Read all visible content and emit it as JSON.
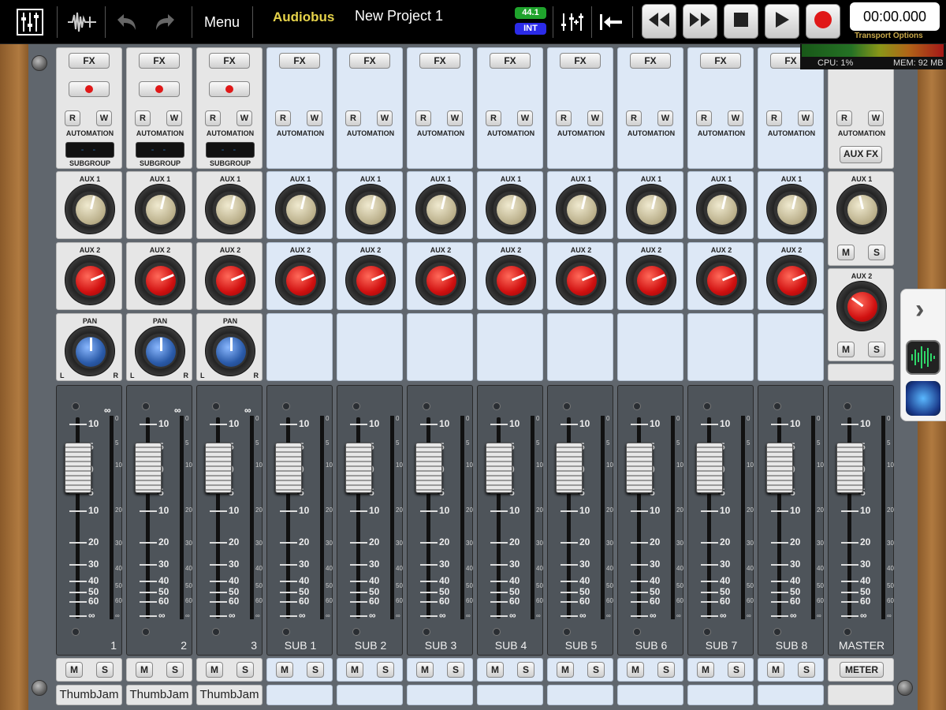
{
  "topbar": {
    "menu_label": "Menu",
    "audiobus_label": "Audiobus",
    "project_title": "New Project 1",
    "sample_rate": "44.1",
    "clock_source": "INT",
    "timecode": "00:00.000",
    "transport_options_label": "Transport Options",
    "icons": [
      "mixer-icon",
      "waveform-edit-icon",
      "undo-icon",
      "redo-icon",
      "add-track-icon",
      "return-to-start-icon",
      "rewind-icon",
      "fast-forward-icon",
      "stop-icon",
      "play-icon",
      "record-icon"
    ]
  },
  "status": {
    "cpu": "CPU:  1%",
    "mem": "MEM: 92 MB"
  },
  "labels": {
    "fx": "FX",
    "r": "R",
    "w": "W",
    "automation": "AUTOMATION",
    "subgroup": "SUBGROUP",
    "aux1": "AUX 1",
    "aux2": "AUX 2",
    "pan": "PAN",
    "pan_l": "L",
    "pan_r": "R",
    "mute": "M",
    "solo": "S",
    "aux_fx": "AUX FX",
    "meter": "METER",
    "link": "∞"
  },
  "fader_scale": [
    "10",
    "5",
    "0",
    "5",
    "10",
    "20",
    "30",
    "40",
    "50",
    "60",
    "∞"
  ],
  "meter_scale": [
    "0",
    "5",
    "10",
    "20",
    "30",
    "40",
    "50",
    "60",
    "∞"
  ],
  "channels": [
    {
      "name": "1",
      "input": "ThumbJam",
      "type": "track",
      "aux1": 0.55,
      "aux2": 0.75,
      "pan": 0.5
    },
    {
      "name": "2",
      "input": "ThumbJam",
      "type": "track",
      "aux1": 0.55,
      "aux2": 0.75,
      "pan": 0.5
    },
    {
      "name": "3",
      "input": "ThumbJam",
      "type": "track",
      "aux1": 0.55,
      "aux2": 0.75,
      "pan": 0.5
    },
    {
      "name": "SUB 1",
      "input": "",
      "type": "sub",
      "aux1": 0.55,
      "aux2": 0.75
    },
    {
      "name": "SUB 2",
      "input": "",
      "type": "sub",
      "aux1": 0.55,
      "aux2": 0.75
    },
    {
      "name": "SUB 3",
      "input": "",
      "type": "sub",
      "aux1": 0.55,
      "aux2": 0.75
    },
    {
      "name": "SUB 4",
      "input": "",
      "type": "sub",
      "aux1": 0.55,
      "aux2": 0.75
    },
    {
      "name": "SUB 5",
      "input": "",
      "type": "sub",
      "aux1": 0.55,
      "aux2": 0.75
    },
    {
      "name": "SUB 6",
      "input": "",
      "type": "sub",
      "aux1": 0.55,
      "aux2": 0.75
    },
    {
      "name": "SUB 7",
      "input": "",
      "type": "sub",
      "aux1": 0.55,
      "aux2": 0.75
    },
    {
      "name": "SUB 8",
      "input": "",
      "type": "sub",
      "aux1": 0.55,
      "aux2": 0.75
    }
  ],
  "master": {
    "name": "MASTER",
    "aux1": 0.45,
    "aux2": 0.3
  },
  "side_panel": {
    "icons": [
      "expand-chevron-icon",
      "audiobus-waveform-app-icon",
      "thumbjam-app-icon"
    ]
  },
  "colors": {
    "accent_yellow": "#e6d34a",
    "rate_green": "#1fa32c",
    "clock_blue": "#2b2be8",
    "record_red": "#e01818"
  }
}
